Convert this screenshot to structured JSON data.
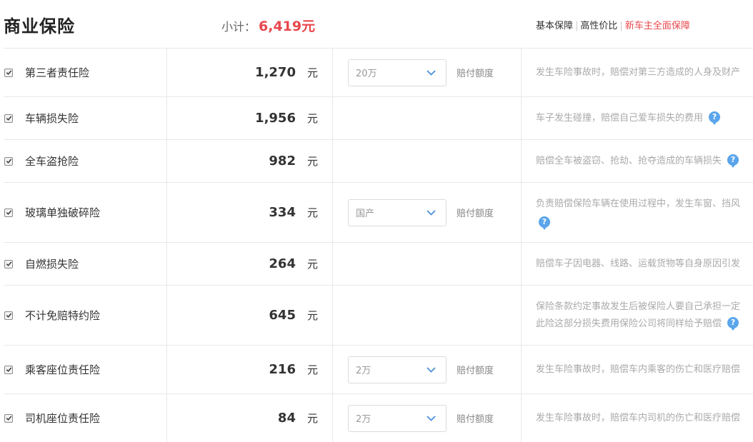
{
  "header": {
    "title": "商业保险",
    "subtotal_label": "小计：",
    "subtotal_value": "6,419元",
    "tabs": [
      {
        "label": "基本保障",
        "active": false
      },
      {
        "label": "高性价比",
        "active": false
      },
      {
        "label": "新车主全面保障",
        "active": true
      }
    ]
  },
  "colors": {
    "accent": "#e8474d",
    "help": "#5aa5ec",
    "border": "#e8e8e8"
  },
  "rows": [
    {
      "name": "第三者责任险",
      "price": "1,270",
      "unit": "元",
      "checked": true,
      "select_value": "20万",
      "select_label": "赔付额度",
      "desc1": "发生车险事故时，赔偿对第三方造成的人身及财产",
      "desc2": "",
      "help": false
    },
    {
      "name": "车辆损失险",
      "price": "1,956",
      "unit": "元",
      "checked": true,
      "select_value": "",
      "select_label": "",
      "desc1": "车子发生碰撞，赔偿自己爱车损失的费用",
      "desc2": "",
      "help": true
    },
    {
      "name": "全车盗抢险",
      "price": "982",
      "unit": "元",
      "checked": true,
      "select_value": "",
      "select_label": "",
      "desc1": "赔偿全车被盗窃、抢劫、抢夺造成的车辆损失",
      "desc2": "",
      "help": true
    },
    {
      "name": "玻璃单独破碎险",
      "price": "334",
      "unit": "元",
      "checked": true,
      "select_value": "国产",
      "select_label": "赔付额度",
      "desc1": "负责赔偿保险车辆在使用过程中，发生车窗、挡风",
      "desc2": "",
      "help": true
    },
    {
      "name": "自燃损失险",
      "price": "264",
      "unit": "元",
      "checked": true,
      "select_value": "",
      "select_label": "",
      "desc1": "赔偿车子因电器、线路、运载货物等自身原因引发",
      "desc2": "",
      "help": false
    },
    {
      "name": "不计免赔特约险",
      "price": "645",
      "unit": "元",
      "checked": true,
      "select_value": "",
      "select_label": "",
      "desc1": "保险条款约定事故发生后被保险人要自己承担一定",
      "desc2": "此险这部分损失费用保险公司将同样给予赔偿",
      "help": true
    },
    {
      "name": "乘客座位责任险",
      "price": "216",
      "unit": "元",
      "checked": true,
      "select_value": "2万",
      "select_label": "赔付额度",
      "desc1": "发生车险事故时，赔偿车内乘客的伤亡和医疗赔偿",
      "desc2": "",
      "help": false
    },
    {
      "name": "司机座位责任险",
      "price": "84",
      "unit": "元",
      "checked": true,
      "select_value": "2万",
      "select_label": "赔付额度",
      "desc1": "发生车险事故时，赔偿车内司机的伤亡和医疗赔偿",
      "desc2": "",
      "help": false
    }
  ]
}
